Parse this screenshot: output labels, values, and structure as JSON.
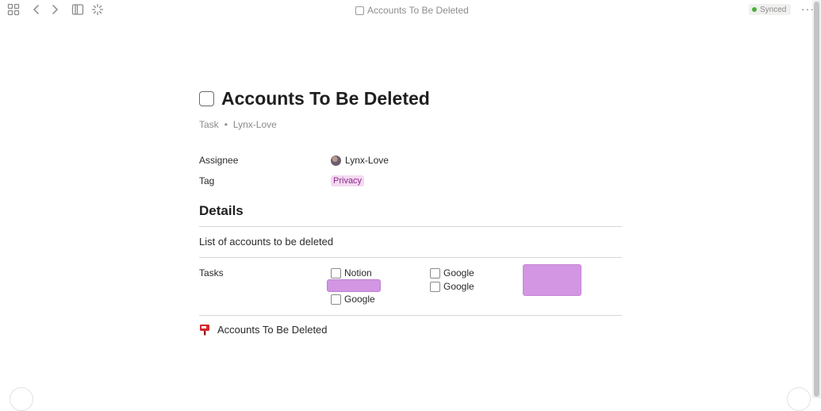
{
  "toolbar": {
    "icons": [
      "grid-icon",
      "chevron-left-icon",
      "chevron-right-icon",
      "sidebar-icon",
      "sparkle-icon"
    ],
    "window_title": "Accounts To Be Deleted",
    "sync_status": "Synced",
    "sync_color": "#4caf3f",
    "more_label": "···"
  },
  "page": {
    "title": "Accounts To Be Deleted",
    "meta": {
      "type": "Task",
      "separator": "•",
      "author": "Lynx-Love"
    },
    "properties": {
      "assignee_label": "Assignee",
      "assignee_value": "Lynx-Love",
      "tag_label": "Tag",
      "tag_value": "Privacy",
      "tag_color": "#8b2a8a"
    },
    "details_heading": "Details",
    "description": "List of accounts to be deleted",
    "tasks_label": "Tasks",
    "tasks": {
      "col1": [
        "Notion",
        "Google"
      ],
      "col2": [
        "Google",
        "Google"
      ]
    },
    "highlight_color": "#d296e2",
    "backlink": "Accounts To Be Deleted"
  }
}
